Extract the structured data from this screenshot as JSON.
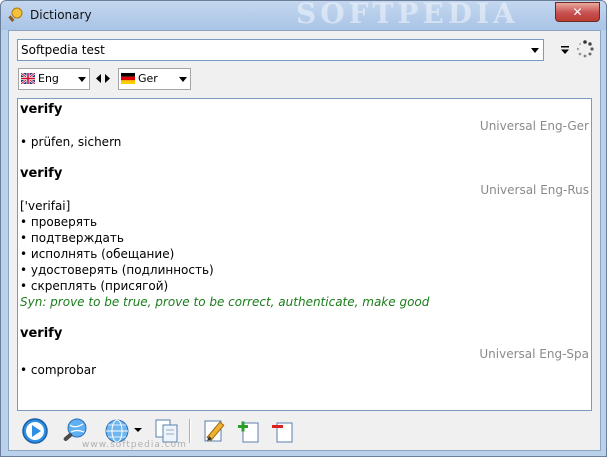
{
  "window": {
    "title": "Dictionary",
    "watermark": "SOFTPEDIA",
    "close_glyph": "✕"
  },
  "search": {
    "value": "Softpedia test",
    "placeholder": ""
  },
  "languages": {
    "from": "Eng",
    "to": "Ger"
  },
  "results": [
    {
      "headword": "verify",
      "source": "Universal Eng-Ger",
      "transcription": "",
      "translations": [
        "• prüfen, sichern"
      ],
      "synonyms": ""
    },
    {
      "headword": "verify",
      "source": "Universal Eng-Rus",
      "transcription": "['verifai]",
      "translations": [
        "• проверять",
        "• подтверждать",
        "• исполнять (обещание)",
        "• удостоверять (подлинность)",
        "• скреплять (присягой)"
      ],
      "synonyms": "Syn: prove to be true, prove to be correct, authenticate, make good"
    },
    {
      "headword": "verify",
      "source": "Universal Eng-Spa",
      "transcription": "",
      "translations": [
        "• comprobar"
      ],
      "synonyms": ""
    }
  ],
  "footer_watermark": "www.softpedia.com",
  "colors": {
    "synonym": "#1a7d1a",
    "source": "#8a8a8a",
    "titlebar": "#b9d1ea"
  },
  "icons": {
    "toolbar": [
      "play-icon",
      "search-globe-icon",
      "globe-icon",
      "copy-icon",
      "edit-icon",
      "add-page-icon",
      "remove-page-icon"
    ]
  }
}
